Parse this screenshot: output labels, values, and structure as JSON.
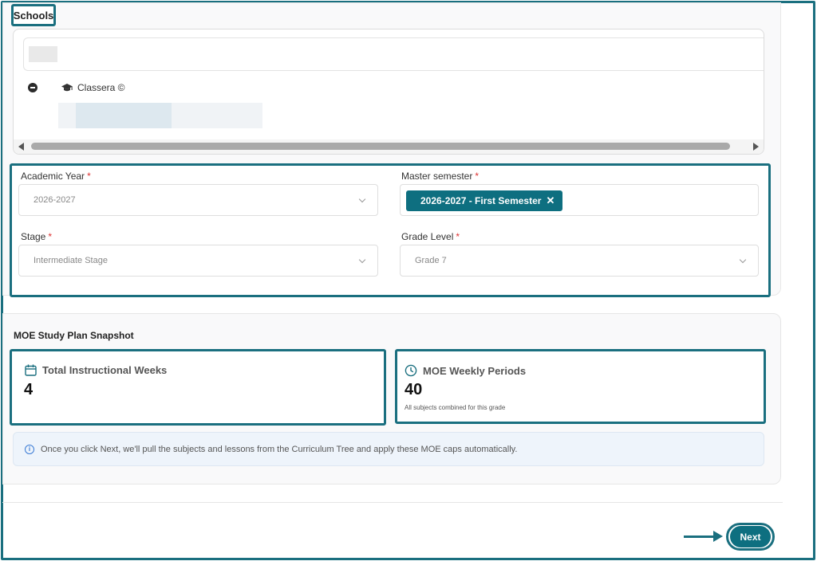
{
  "schools": {
    "label": "Schools",
    "tree_root_label": "Classera ©"
  },
  "form": {
    "academic_year": {
      "label": "Academic Year",
      "required": "*",
      "value": "2026-2027"
    },
    "master_semester": {
      "label": "Master semester",
      "required": "*",
      "tag": "2026-2027 - First Semester",
      "tag_remove": "✕"
    },
    "stage": {
      "label": "Stage",
      "required": "*",
      "value": "Intermediate Stage"
    },
    "grade_level": {
      "label": "Grade Level",
      "required": "*",
      "value": "Grade 7"
    }
  },
  "snapshot": {
    "title": "MOE Study Plan Snapshot",
    "weeks": {
      "title": "Total Instructional Weeks",
      "value": "4",
      "icon": "calendar-icon"
    },
    "periods": {
      "title": "MOE Weekly Periods",
      "value": "40",
      "subtitle": "All subjects combined for this grade",
      "icon": "clock-icon"
    },
    "info": "Once you click Next, we'll pull the subjects and lessons from the Curriculum Tree and apply these MOE caps automatically."
  },
  "footer": {
    "next_label": "Next"
  },
  "colors": {
    "accent": "#0e6f80",
    "highlight": "#1a6f7f",
    "required": "#d33333",
    "info": "#3a7bd5"
  }
}
